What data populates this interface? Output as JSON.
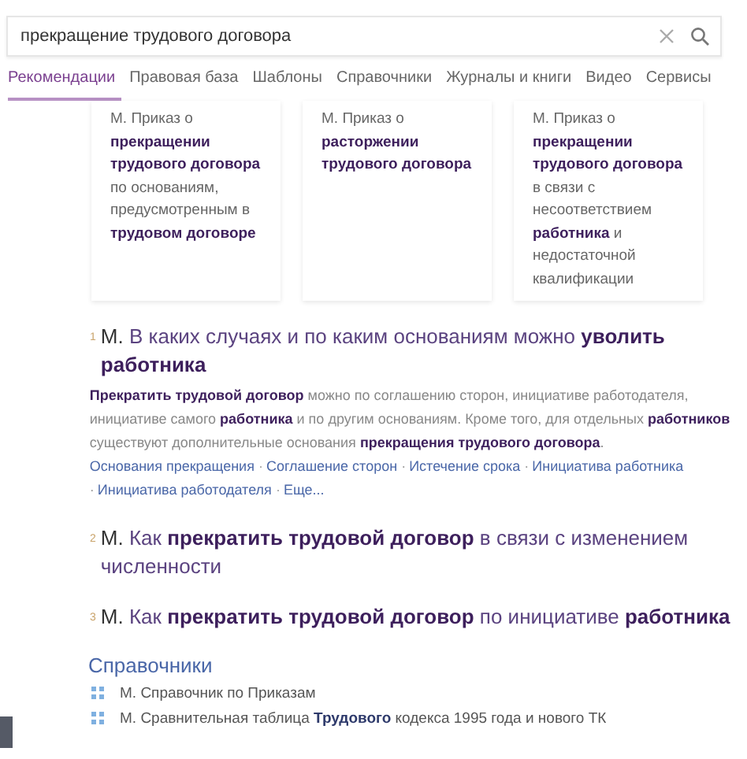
{
  "search": {
    "value": "прекращение трудового договора"
  },
  "tabs": [
    {
      "label": "Рекомендации",
      "selected": true
    },
    {
      "label": "Правовая база",
      "selected": false
    },
    {
      "label": "Шаблоны",
      "selected": false
    },
    {
      "label": "Справочники",
      "selected": false
    },
    {
      "label": "Журналы и книги",
      "selected": false
    },
    {
      "label": "Видео",
      "selected": false
    },
    {
      "label": "Сервисы",
      "selected": false
    }
  ],
  "cards": [
    {
      "text": "М. Приказ о **прекращении трудового договора** по основаниям, предусмотренным в **трудовом договоре**"
    },
    {
      "text": "М. Приказ о **расторжении трудового договора**"
    },
    {
      "text": "М. Приказ о **прекращении трудового договора** в связи с несоответствием **работника** и недостаточной квалификации"
    }
  ],
  "results": [
    {
      "number": "1",
      "prefix": "М.",
      "title": "В каких случаях и по каким основаниям можно **уволить работника**",
      "snippet": "**Прекратить трудовой договор** можно по соглашению сторон, инициативе работодателя, инициативе самого **работника** и по другим основаниям. Кроме того, для отдельных **работников** существуют дополнительные основания **прекращения трудового договора**.",
      "separator": "·",
      "links": [
        "Основания прекращения",
        "Соглашение сторон",
        "Истечение срока",
        "Инициатива работника",
        "Инициатива работодателя",
        "Еще..."
      ]
    },
    {
      "number": "2",
      "prefix": "М.",
      "title": "Как **прекратить трудовой договор** в связи с изменением численности"
    },
    {
      "number": "3",
      "prefix": "М.",
      "title": "Как **прекратить трудовой договор** по инициативе **работника**"
    }
  ],
  "reference": {
    "heading": "Справочники",
    "items": [
      "М. Справочник по Приказам",
      "М. Сравнительная таблица **Трудового** кодекса 1995 года и нового ТК"
    ]
  }
}
